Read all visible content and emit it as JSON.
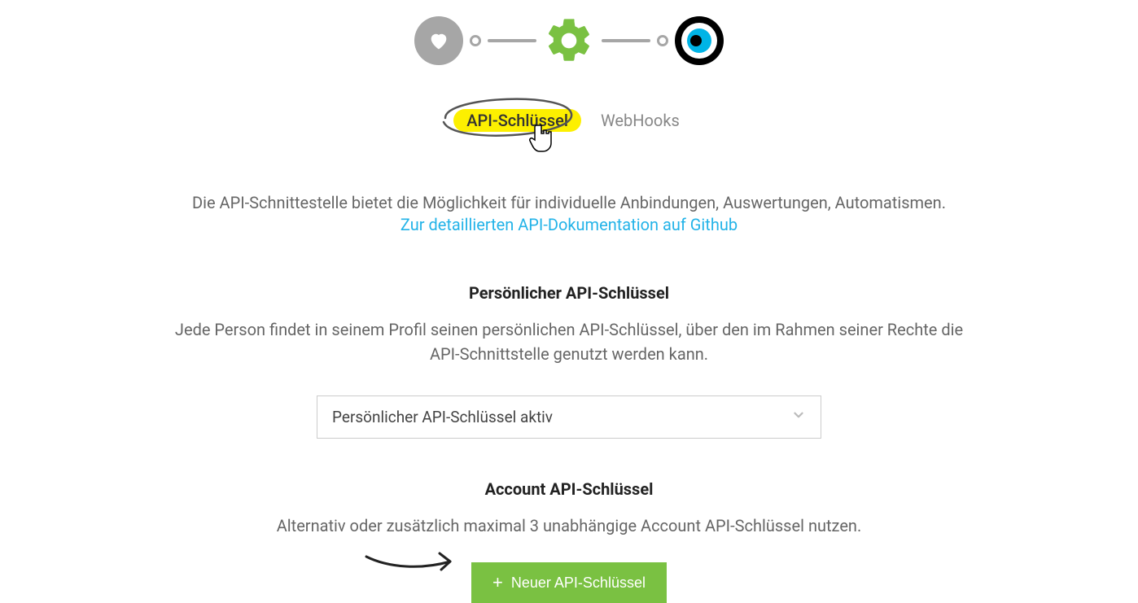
{
  "tabs": {
    "api_key": "API-Schlüssel",
    "webhooks": "WebHooks"
  },
  "intro": {
    "text": "Die API-Schnittestelle bietet die Möglichkeit für individuelle Anbindungen, Auswertungen, Automatismen.",
    "link_text": "Zur detaillierten API-Dokumentation auf Github"
  },
  "personal": {
    "title": "Persönlicher API-Schlüssel",
    "desc": "Jede Person findet in seinem Profil seinen persönlichen API-Schlüssel, über den im Rahmen seiner Rechte die API-Schnittstelle genutzt werden kann.",
    "select_value": "Persönlicher API-Schlüssel aktiv"
  },
  "account": {
    "title": "Account API-Schlüssel",
    "desc": "Alternativ oder zusätzlich maximal 3 unabhängige Account API-Schlüssel nutzen.",
    "button_label": "Neuer API-Schlüssel"
  }
}
